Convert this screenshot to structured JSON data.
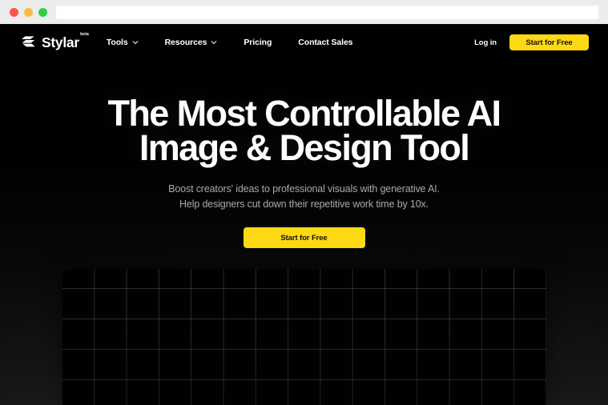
{
  "browser": {
    "traffic_lights": [
      {
        "name": "close",
        "color": "#f9564f"
      },
      {
        "name": "minimize",
        "color": "#fcbc40"
      },
      {
        "name": "maximize",
        "color": "#31cc4b"
      }
    ],
    "url_value": "",
    "url_placeholder": ""
  },
  "theme": {
    "accent_yellow": "#fcd913",
    "page_background": "#000000",
    "text_primary": "#ffffff",
    "text_muted": "#a9a9a9"
  },
  "navbar": {
    "brand": {
      "logo_icon": "stylar-s-logo-icon",
      "name": "Stylar",
      "badge": "beta"
    },
    "links": [
      {
        "label": "Tools",
        "has_dropdown": true,
        "icon": "chevron-down-icon"
      },
      {
        "label": "Resources",
        "has_dropdown": true,
        "icon": "chevron-down-icon"
      },
      {
        "label": "Pricing",
        "has_dropdown": false
      },
      {
        "label": "Contact Sales",
        "has_dropdown": false
      }
    ],
    "login_label": "Log in",
    "cta_label": "Start for Free"
  },
  "hero": {
    "title_line1": "The Most Controllable AI",
    "title_line2": "Image & Design Tool",
    "subtitle_line1": "Boost creators' ideas to professional visuals with generative AI.",
    "subtitle_line2": "Help designers cut down their repetitive work time by 10x.",
    "cta_label": "Start for Free"
  },
  "canvas_preview": {
    "name": "grid-canvas"
  }
}
